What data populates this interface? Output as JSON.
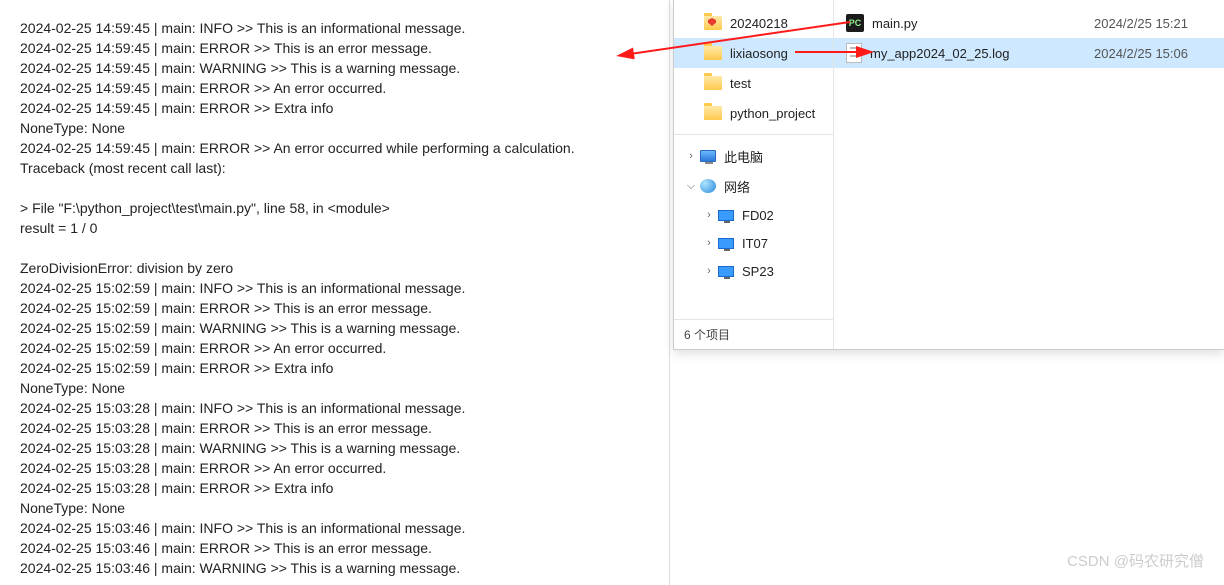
{
  "log": {
    "lines": [
      "2024-02-25 14:59:45 | main: INFO >> This is an informational message.",
      "2024-02-25 14:59:45 | main: ERROR >> This is an error message.",
      "2024-02-25 14:59:45 | main: WARNING >> This is a warning message.",
      "2024-02-25 14:59:45 | main: ERROR >> An error occurred.",
      "2024-02-25 14:59:45 | main: ERROR >> Extra info",
      "NoneType: None",
      "2024-02-25 14:59:45 | main: ERROR >> An error occurred while performing a calculation.",
      "Traceback (most recent call last):",
      "",
      "> File \"F:\\python_project\\test\\main.py\", line 58, in <module>",
      "    result = 1 / 0",
      "",
      "ZeroDivisionError: division by zero",
      "2024-02-25 15:02:59 | main: INFO >> This is an informational message.",
      "2024-02-25 15:02:59 | main: ERROR >> This is an error message.",
      "2024-02-25 15:02:59 | main: WARNING >> This is a warning message.",
      "2024-02-25 15:02:59 | main: ERROR >> An error occurred.",
      "2024-02-25 15:02:59 | main: ERROR >> Extra info",
      "NoneType: None",
      "2024-02-25 15:03:28 | main: INFO >> This is an informational message.",
      "2024-02-25 15:03:28 | main: ERROR >> This is an error message.",
      "2024-02-25 15:03:28 | main: WARNING >> This is a warning message.",
      "2024-02-25 15:03:28 | main: ERROR >> An error occurred.",
      "2024-02-25 15:03:28 | main: ERROR >> Extra info",
      "NoneType: None",
      "2024-02-25 15:03:46 | main: INFO >> This is an informational message.",
      "2024-02-25 15:03:46 | main: ERROR >> This is an error message.",
      "2024-02-25 15:03:46 | main: WARNING >> This is a warning message."
    ]
  },
  "explorer": {
    "nav": {
      "folders": [
        {
          "label": "20240218",
          "shield": true
        },
        {
          "label": "lixiaosong",
          "shield": false
        },
        {
          "label": "test",
          "shield": false
        },
        {
          "label": "python_project",
          "shield": false
        }
      ],
      "thisPC": {
        "label": "此电脑",
        "chevron": "›"
      },
      "network": {
        "label": "网络",
        "chevron": "⌵",
        "items": [
          {
            "label": "FD02",
            "chevron": "›"
          },
          {
            "label": "IT07",
            "chevron": "›"
          },
          {
            "label": "SP23",
            "chevron": "›"
          }
        ]
      },
      "footer": "6 个项目"
    },
    "files": [
      {
        "name": "main.py",
        "date": "2024/2/25 15:21",
        "type": "py",
        "selected": false
      },
      {
        "name": "my_app2024_02_25.log",
        "date": "2024/2/25 15:06",
        "type": "log",
        "selected": true
      }
    ]
  },
  "watermark": "CSDN @码农研究僧"
}
